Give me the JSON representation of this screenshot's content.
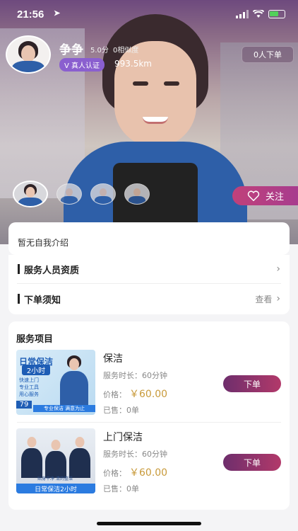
{
  "status_bar": {
    "time": "21:56"
  },
  "profile": {
    "name": "争争",
    "score": "5.0分",
    "similarity": "0相似度",
    "verified_label": "真人认证",
    "distance": "993.5km",
    "orders_badge": "0人下单",
    "follow_label": "关注"
  },
  "intro": {
    "text": "暂无自我介绍"
  },
  "info_rows": [
    {
      "label": "服务人员资质",
      "action": ""
    },
    {
      "label": "下单须知",
      "action": "查看"
    }
  ],
  "services": {
    "title": "服务项目",
    "items": [
      {
        "name": "保洁",
        "duration": "服务时长：60分钟",
        "price_label": "价格：",
        "price": "￥60.00",
        "sold": "已售：0单",
        "button": "下单",
        "image_text": {
          "headline": "日常保洁",
          "sub": "2小时",
          "bullets": [
            "快速上门",
            "专业工具",
            "用心服务"
          ],
          "number": "79",
          "footer": "专业保洁 满意为止"
        }
      },
      {
        "name": "上门保洁",
        "duration": "服务时长：60分钟",
        "price_label": "价格：",
        "price": "￥60.00",
        "sold": "已售：0单",
        "button": "下单",
        "image_text": {
          "caption": "贴身干净 清的整洁",
          "footer": "日常保洁2小时"
        }
      }
    ]
  },
  "colors": {
    "accent": "#b2396a",
    "price": "#c89a3a",
    "verified": "#8a5fcf"
  },
  "icons": [
    "location-arrow-icon",
    "signal-icon",
    "wifi-icon",
    "battery-icon",
    "heart-icon",
    "chevron-right-icon"
  ]
}
